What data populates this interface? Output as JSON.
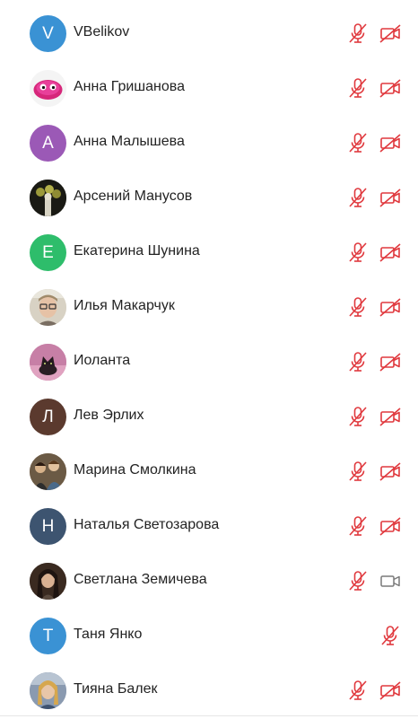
{
  "colors": {
    "muted_red": "#e0393e",
    "cam_on_gray": "#7a7a7a",
    "text": "#232323"
  },
  "participants": [
    {
      "name": "VBelikov",
      "initial": "V",
      "avatar_color": "#3a92d4",
      "avatar_type": "initial",
      "mic": "muted",
      "camera": "off"
    },
    {
      "name": "Анна Гришанова",
      "initial": "",
      "avatar_color": "#f5f5f5",
      "avatar_type": "photo-pink-monster",
      "mic": "muted",
      "camera": "off"
    },
    {
      "name": "Анна Малышева",
      "initial": "А",
      "avatar_color": "#9b59b6",
      "avatar_type": "initial",
      "mic": "muted",
      "camera": "off"
    },
    {
      "name": "Арсений Манусов",
      "initial": "",
      "avatar_color": "#1f1f1f",
      "avatar_type": "photo-dark-figure",
      "mic": "muted",
      "camera": "off"
    },
    {
      "name": "Екатерина Шунина",
      "initial": "Е",
      "avatar_color": "#2ebd6b",
      "avatar_type": "initial",
      "mic": "muted",
      "camera": "off"
    },
    {
      "name": "Илья Макарчук",
      "initial": "",
      "avatar_color": "#d8d2c4",
      "avatar_type": "photo-man-glasses",
      "mic": "muted",
      "camera": "off"
    },
    {
      "name": "Иоланта",
      "initial": "",
      "avatar_color": "#c0709a",
      "avatar_type": "photo-pink-cat",
      "mic": "muted",
      "camera": "off"
    },
    {
      "name": "Лев Эрлих",
      "initial": "Л",
      "avatar_color": "#5b3a2e",
      "avatar_type": "initial",
      "mic": "muted",
      "camera": "off"
    },
    {
      "name": "Марина Смолкина",
      "initial": "",
      "avatar_color": "#8a6a4a",
      "avatar_type": "photo-group",
      "mic": "muted",
      "camera": "off"
    },
    {
      "name": "Наталья Светозарова",
      "initial": "Н",
      "avatar_color": "#3d5470",
      "avatar_type": "initial",
      "mic": "muted",
      "camera": "off"
    },
    {
      "name": "Светлана Земичева",
      "initial": "",
      "avatar_color": "#3a2a20",
      "avatar_type": "photo-woman-dark",
      "mic": "muted",
      "camera": "on"
    },
    {
      "name": "Таня Янко",
      "initial": "Т",
      "avatar_color": "#3a92d4",
      "avatar_type": "initial",
      "mic": "muted",
      "camera": "none"
    },
    {
      "name": "Тияна Балек",
      "initial": "",
      "avatar_color": "#7a8aa0",
      "avatar_type": "photo-woman-blonde",
      "mic": "muted",
      "camera": "off"
    }
  ]
}
